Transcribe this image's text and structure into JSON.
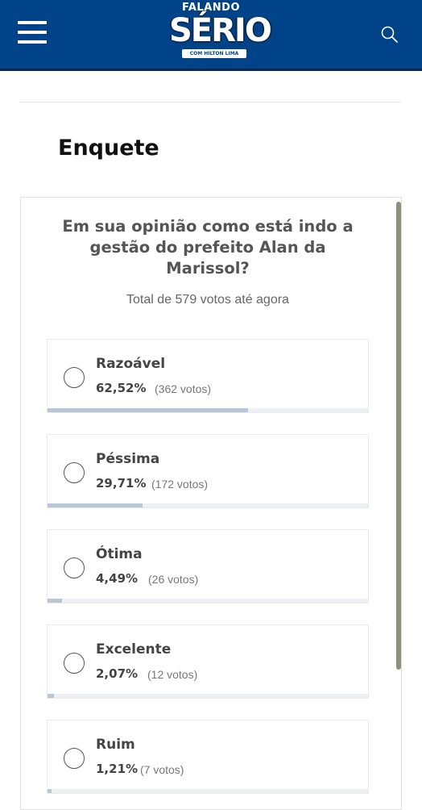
{
  "header": {
    "logo_top": "FALANDO",
    "logo_main": "SÉRIO",
    "logo_sub": "COM HILTON LIMA",
    "background_color": "#004389",
    "menu_icon": "hamburger-icon",
    "search_icon": "search-icon"
  },
  "page": {
    "title": "Enquete"
  },
  "poll": {
    "question": "Em sua opinião como está indo a gestão do prefeito Alan da Marissol?",
    "total": "Total de 579 votos até agora",
    "bar_color": "#b7c7d6",
    "options": [
      {
        "label": "Razoável",
        "percent": "62,52%",
        "votes": "(362 votos)",
        "fraction": 0.6252
      },
      {
        "label": "Péssima",
        "percent": "29,71%",
        "votes": "(172 votos)",
        "fraction": 0.2971
      },
      {
        "label": "Ótima",
        "percent": "4,49%",
        "votes": "(26 votos)",
        "fraction": 0.0449
      },
      {
        "label": "Excelente",
        "percent": "2,07%",
        "votes": "(12 votos)",
        "fraction": 0.0207
      },
      {
        "label": "Ruim",
        "percent": "1,21%",
        "votes": "(7 votos)",
        "fraction": 0.0121
      }
    ]
  }
}
